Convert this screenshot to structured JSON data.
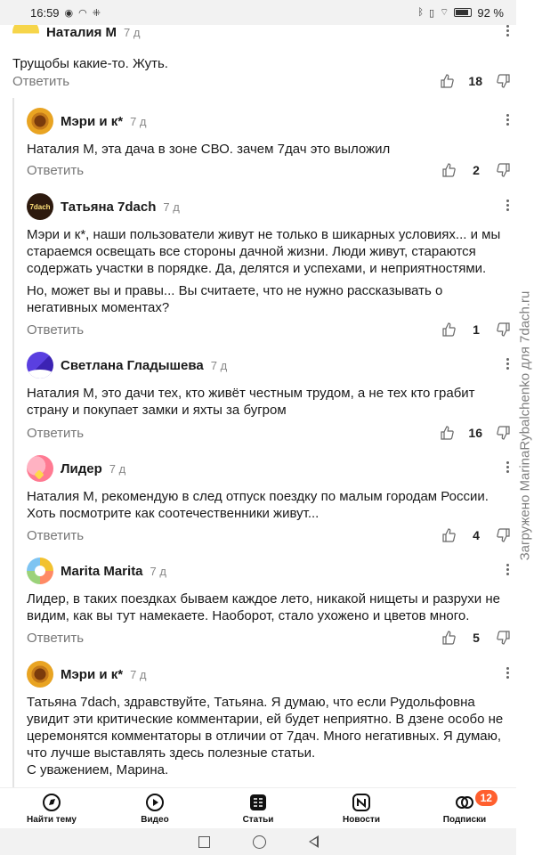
{
  "status_bar": {
    "time": "16:59",
    "left_icons": [
      "notification-icon",
      "wifi-assist-icon",
      "apps-icon"
    ],
    "right_icons": [
      "bluetooth-icon",
      "vibrate-icon",
      "wifi-icon",
      "battery-icon"
    ],
    "battery": "92 %"
  },
  "reply_label": "Ответить",
  "comments": [
    {
      "author": "Наталия М",
      "time": "7 д",
      "text": [
        "Трущобы какие-то. Жуть."
      ],
      "likes": "18"
    },
    {
      "author": "Мэри и к*",
      "time": "7 д",
      "text": [
        "Наталия М, эта дача в зоне СВО. зачем 7дач это выложил"
      ],
      "likes": "2"
    },
    {
      "author": "Татьяна 7dach",
      "time": "7 д",
      "avatar_text": "7dach",
      "text": [
        "Мэри и к*, наши пользователи живут не только в шикарных условиях... и мы стараемся освещать все стороны дачной жизни. Люди живут, стараются содержать участки в порядке. Да, делятся и успехами, и неприятностями.",
        "Но, может вы и правы... Вы считаете, что не нужно рассказывать о негативных моментах?"
      ],
      "likes": "1"
    },
    {
      "author": "Светлана Гладышева",
      "time": "7 д",
      "text": [
        "Наталия М, это дачи тех, кто живёт честным трудом, а не тех кто грабит страну и покупает замки и яхты за бугром"
      ],
      "likes": "16"
    },
    {
      "author": "Лидер",
      "time": "7 д",
      "text": [
        "Наталия М, рекомендую в след отпуск поездку по малым городам России. Хоть посмотрите как соотечественники живут..."
      ],
      "likes": "4"
    },
    {
      "author": "Marita Marita",
      "time": "7 д",
      "text": [
        "Лидер, в таких поездках бываем каждое лето, никакой нищеты и разрухи не видим, как вы тут намекаете. Наоборот, стало ухожено и цветов много."
      ],
      "likes": "5"
    },
    {
      "author": "Мэри и к*",
      "time": "7 д",
      "text": [
        "Татьяна 7dach, здравствуйте, Татьяна. Я думаю, что если Рудольфовна увидит эти критические комментарии, ей будет неприятно. В дзене особо не церемонятся комментаторы в отличии от 7дач. Много негативных. Я думаю, что лучше выставлять здесь полезные статьи.",
        "С уважением, Марина."
      ],
      "likes": ""
    }
  ],
  "watermark": "Загружено MarinaRybalchenko для 7dach.ru",
  "tabs": [
    {
      "label": "Найти тему",
      "icon": "compass-icon"
    },
    {
      "label": "Видео",
      "icon": "play-icon"
    },
    {
      "label": "Статьи",
      "icon": "articles-icon"
    },
    {
      "label": "Новости",
      "icon": "news-icon"
    },
    {
      "label": "Подписки",
      "icon": "subscriptions-icon",
      "badge": "12"
    }
  ],
  "colors": {
    "accent_badge": "#ff5f2e",
    "secondary_text": "#777777"
  }
}
